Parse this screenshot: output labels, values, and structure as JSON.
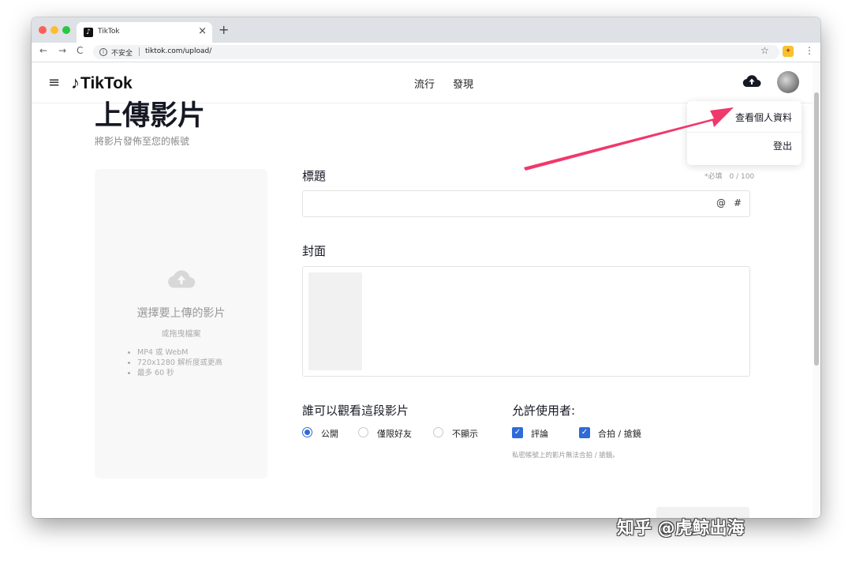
{
  "browser": {
    "tab_title": "TikTok",
    "tab_close": "×",
    "new_tab": "+",
    "nav_back": "←",
    "nav_forward": "→",
    "nav_reload": "C",
    "info_glyph": "i",
    "security_label": "不安全",
    "url": "tiktok.com/upload/",
    "star": "☆",
    "extension_glyph": "✦",
    "menu": "⋮"
  },
  "header": {
    "menu_glyph": "≡",
    "logo_note": "♪",
    "logo_text": "TikTok",
    "nav": [
      {
        "label": "流行"
      },
      {
        "label": "發現"
      }
    ],
    "upload_icon": "cloud-upload-icon"
  },
  "page": {
    "title": "上傳影片",
    "subtitle": "將影片發佈至您的帳號"
  },
  "dropzone": {
    "icon": "cloud-upload-icon",
    "main_text": "選擇要上傳的影片",
    "sub_text": "或拖曳檔案",
    "requirements": [
      "MP4 或 WebM",
      "720x1280 解析度或更高",
      "最多 60 秒"
    ]
  },
  "form": {
    "caption_label": "標題",
    "caption_counter": "*必填　0 / 100",
    "caption_value": "",
    "at_symbol": "@",
    "hash_symbol": "#",
    "cover_label": "封面",
    "visibility_label": "誰可以觀看這段影片",
    "visibility_options": [
      {
        "label": "公開",
        "selected": true
      },
      {
        "label": "僅限好友",
        "selected": false
      },
      {
        "label": "不顯示",
        "selected": false
      }
    ],
    "allow_label": "允許使用者:",
    "allow_options": [
      {
        "label": "評論",
        "checked": true
      },
      {
        "label": "合拍 / 搶鏡",
        "checked": true
      }
    ],
    "private_note": "私密帳號上的影片無法合拍 / 搶鏡。",
    "check_glyph": "✓"
  },
  "dropdown": {
    "items": [
      {
        "label": "查看個人資料"
      },
      {
        "label": "登出"
      }
    ]
  },
  "annotation": {
    "arrow_color": "#f0386b"
  },
  "colors": {
    "accent_blue": "#2e6bd8",
    "tab_bar": "#dee1e6"
  },
  "watermark": "知乎 @虎鲸出海"
}
